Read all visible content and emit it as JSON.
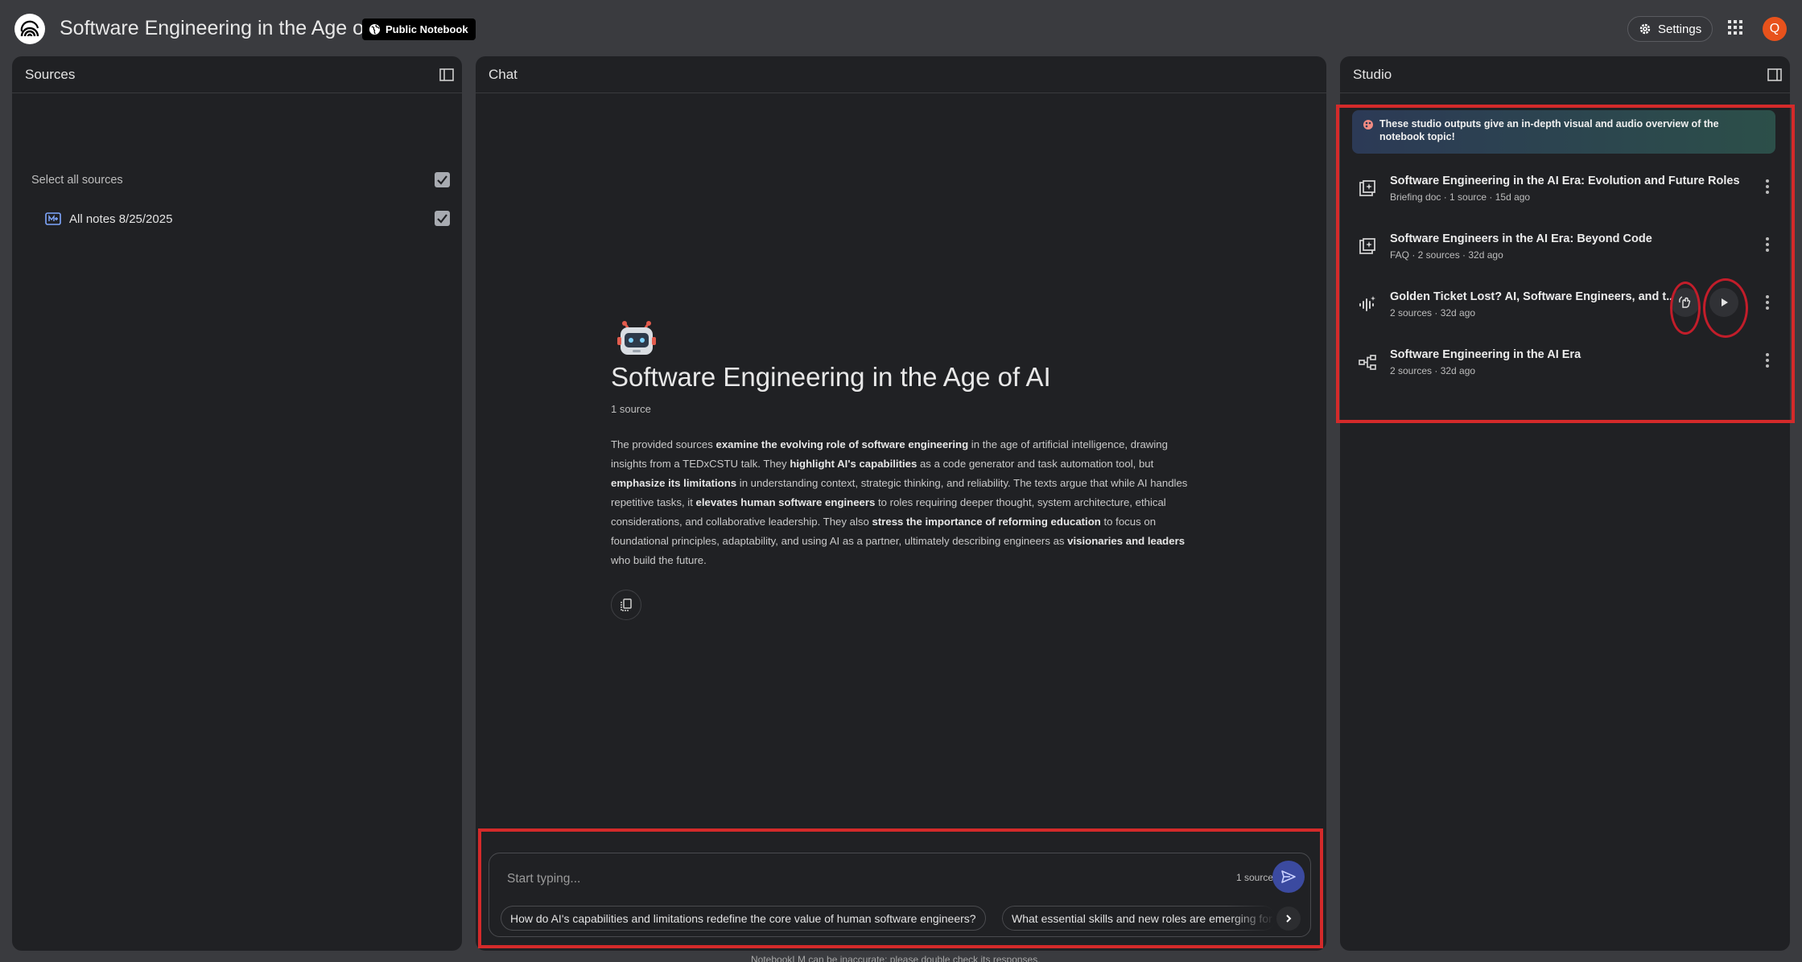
{
  "header": {
    "title": "Software Engineering in the Age of AI",
    "badge": "Public Notebook",
    "settings_label": "Settings",
    "avatar_letter": "Q"
  },
  "sources": {
    "title": "Sources",
    "select_all_label": "Select all sources",
    "items": [
      {
        "label": "All notes 8/25/2025",
        "icon": "note-icon",
        "checked": true
      }
    ]
  },
  "chat": {
    "title": "Chat",
    "notebook_title": "Software Engineering in the Age of AI",
    "source_count": "1 source",
    "summary": [
      {
        "t": "The provided sources ",
        "b": false
      },
      {
        "t": "examine the evolving role of software engineering",
        "b": true
      },
      {
        "t": " in the age of artificial intelligence, drawing insights from a TEDxCSTU talk. They ",
        "b": false
      },
      {
        "t": "highlight AI's capabilities",
        "b": true
      },
      {
        "t": " as a code generator and task automation tool, but ",
        "b": false
      },
      {
        "t": "emphasize its limitations",
        "b": true
      },
      {
        "t": " in understanding context, strategic thinking, and reliability. The texts argue that while AI handles repetitive tasks, it ",
        "b": false
      },
      {
        "t": "elevates human software engineers",
        "b": true
      },
      {
        "t": " to roles requiring deeper thought, system architecture, ethical considerations, and collaborative leadership. They also ",
        "b": false
      },
      {
        "t": "stress the importance of reforming education",
        "b": true
      },
      {
        "t": " to focus on foundational principles, adaptability, and using AI as a partner, ultimately describing engineers as ",
        "b": false
      },
      {
        "t": "visionaries and leaders",
        "b": true
      },
      {
        "t": " who build the future.",
        "b": false
      }
    ],
    "input_placeholder": "Start typing...",
    "input_source_count": "1 source",
    "suggestions": [
      "How do AI's capabilities and limitations redefine the core value of human software engineers?",
      "What essential skills and new roles are emerging for software engineers"
    ]
  },
  "studio": {
    "title": "Studio",
    "banner": "These studio outputs give an in-depth visual and audio overview of the notebook topic!",
    "items": [
      {
        "title": "Software Engineering in the AI Era: Evolution and Future Roles",
        "meta": "Briefing doc · 1 source · 15d ago",
        "icon": "doc-sparkle-icon"
      },
      {
        "title": "Software Engineers in the AI Era: Beyond Code",
        "meta": "FAQ · 2 sources · 32d ago",
        "icon": "doc-sparkle-icon"
      },
      {
        "title": "Golden Ticket Lost? AI, Software Engineers, and t...",
        "meta": "2 sources · 32d ago",
        "icon": "audio-wave-icon"
      },
      {
        "title": "Software Engineering in the AI Era",
        "meta": "2 sources · 32d ago",
        "icon": "mind-map-icon"
      }
    ]
  },
  "footer": "NotebookLM can be inaccurate; please double check its responses.",
  "colors": {
    "background": "#3a3b3f",
    "panel": "#202124",
    "avatar": "#e8521c",
    "send": "#3b4aa0",
    "highlight_box": "#d42a2a"
  }
}
